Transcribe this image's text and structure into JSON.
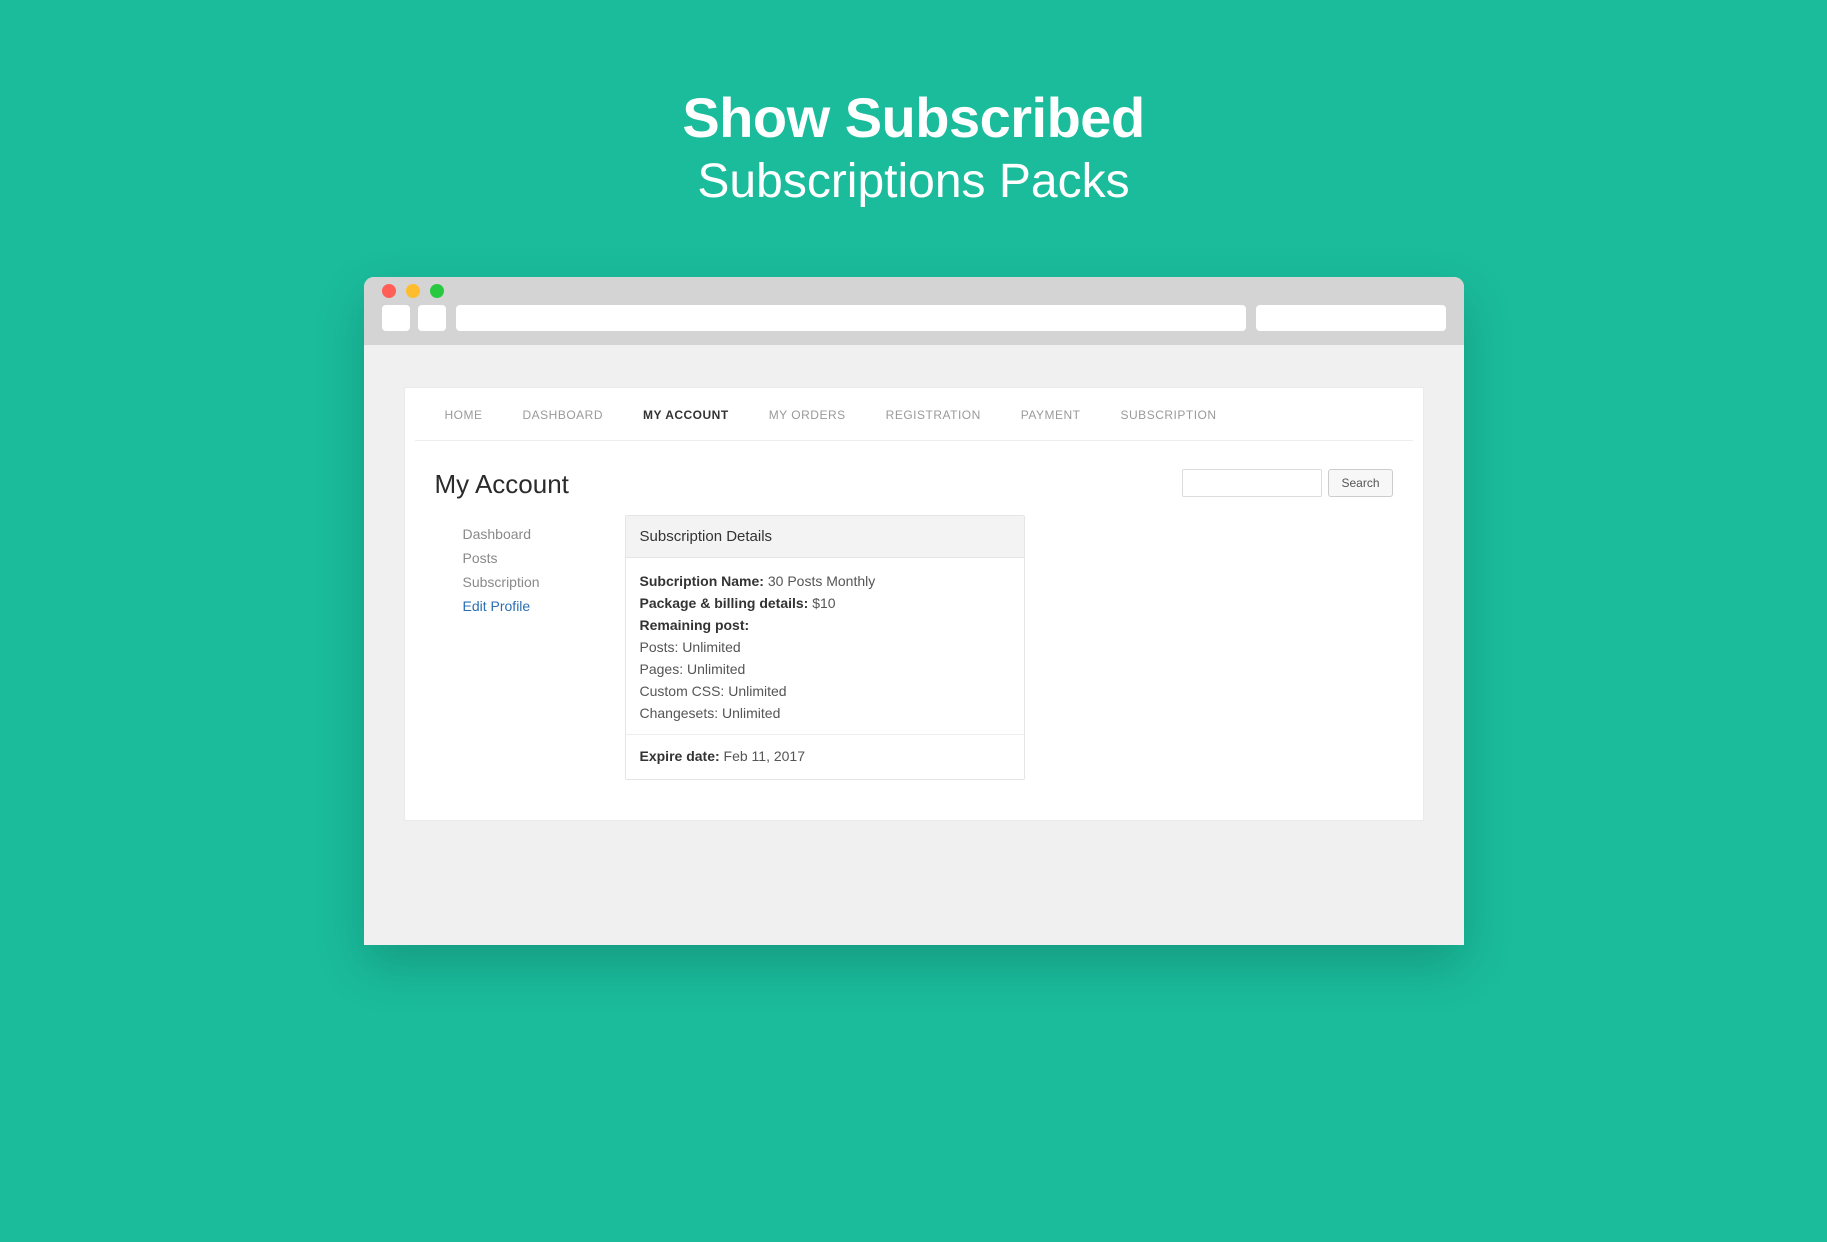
{
  "hero": {
    "line1": "Show Subscribed",
    "line2": "Subscriptions Packs"
  },
  "topnav": {
    "items": [
      {
        "label": "HOME"
      },
      {
        "label": "DASHBOARD"
      },
      {
        "label": "MY ACCOUNT"
      },
      {
        "label": "MY ORDERS"
      },
      {
        "label": "REGISTRATION"
      },
      {
        "label": "PAYMENT"
      },
      {
        "label": "SUBSCRIPTION"
      }
    ],
    "active_index": 2
  },
  "page": {
    "title": "My Account"
  },
  "search": {
    "button_label": "Search",
    "value": ""
  },
  "sidemenu": {
    "items": [
      {
        "label": "Dashboard",
        "link": false
      },
      {
        "label": "Posts",
        "link": false
      },
      {
        "label": "Subscription",
        "link": false
      },
      {
        "label": "Edit Profile",
        "link": true
      }
    ]
  },
  "panel": {
    "title": "Subscription Details",
    "subscription_name_label": "Subcription Name:",
    "subscription_name_value": "30 Posts Monthly",
    "package_label": "Package & billing details:",
    "package_value": "$10",
    "remaining_label": "Remaining post:",
    "remaining_items": [
      {
        "label": "Posts:",
        "value": "Unlimited"
      },
      {
        "label": "Pages:",
        "value": "Unlimited"
      },
      {
        "label": "Custom CSS:",
        "value": "Unlimited"
      },
      {
        "label": "Changesets:",
        "value": "Unlimited"
      }
    ],
    "expire_label": "Expire date:",
    "expire_value": "Feb 11, 2017"
  }
}
